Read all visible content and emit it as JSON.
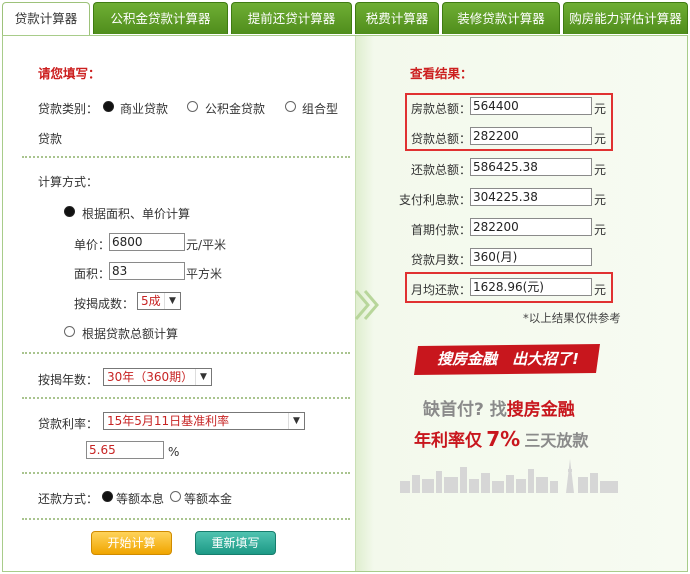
{
  "tabs": [
    {
      "label": "贷款计算器"
    },
    {
      "label": "公积金贷款计算器"
    },
    {
      "label": "提前还贷计算器"
    },
    {
      "label": "税费计算器"
    },
    {
      "label": "装修贷款计算器"
    },
    {
      "label": "购房能力评估计算器"
    }
  ],
  "form": {
    "heading": "请您填写：",
    "loan_type_label": "贷款类别：",
    "loan_type_options": [
      "商业贷款",
      "公积金贷款",
      "组合型"
    ],
    "loan_type_suffix": "贷款",
    "calc_method_label": "计算方式：",
    "method_area": "根据面积、单价计算",
    "unit_price_label": "单价：",
    "unit_price_value": "6800",
    "unit_price_unit": "元/平米",
    "area_label": "面积：",
    "area_value": "83",
    "area_unit": "平方米",
    "ratio_label": "按揭成数：",
    "ratio_value": "5成",
    "method_total": "根据贷款总额计算",
    "years_label": "按揭年数：",
    "years_value": "30年（360期）",
    "rate_label": "贷款利率：",
    "rate_value": "15年5月11日基准利率",
    "rate_input": "5.65",
    "rate_unit": "%",
    "repay_label": "还款方式：",
    "repay_options": [
      "等额本息",
      "等额本金"
    ],
    "calc_button": "开始计算",
    "reset_button": "重新填写"
  },
  "results": {
    "heading": "查看结果：",
    "rows": [
      {
        "label": "房款总额：",
        "value": "564400",
        "unit": "元"
      },
      {
        "label": "贷款总额：",
        "value": "282200",
        "unit": "元"
      },
      {
        "label": "还款总额：",
        "value": "586425.38",
        "unit": "元"
      },
      {
        "label": "支付利息款：",
        "value": "304225.38",
        "unit": "元"
      },
      {
        "label": "首期付款：",
        "value": "282200",
        "unit": "元"
      },
      {
        "label": "贷款月数：",
        "value": "360(月)",
        "unit": ""
      },
      {
        "label": "月均还款：",
        "value": "1628.96(元)",
        "unit": "元"
      }
    ],
    "note": "*以上结果仅供参考"
  },
  "ad": {
    "banner": "搜房金融　出大招了!",
    "line1_a": "缺首付?",
    "line1_b": "找",
    "line1_c": "搜房金融",
    "line2_a": "年利率仅",
    "line2_b": "7%",
    "line2_c": "三天放款"
  },
  "colors": {
    "tab_green": "#5a9a26",
    "accent_red": "#cc1f1f",
    "panel_border": "#a8cc8a"
  }
}
